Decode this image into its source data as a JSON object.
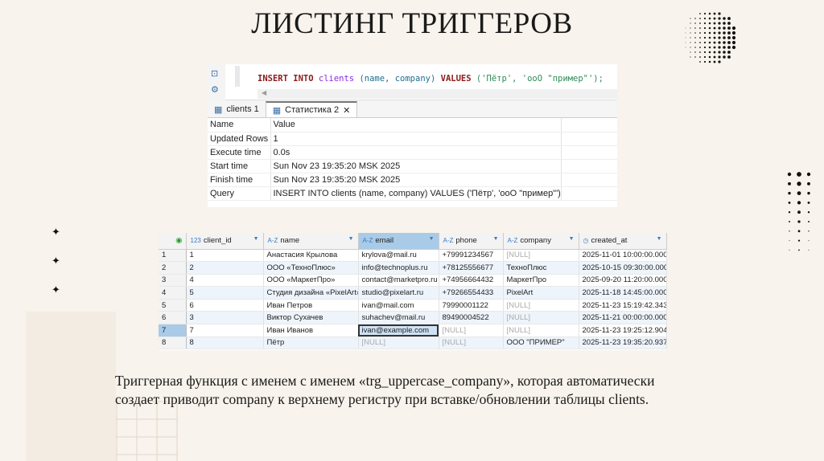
{
  "title": "ЛИСТИНГ ТРИГГЕРОВ",
  "editor": {
    "kw1": "INSERT INTO",
    "table": "clients",
    "cols": "(name, company)",
    "kw2": "VALUES",
    "vals": "('Пётр', 'ооО \"пример\"');",
    "scroll_left": "◀"
  },
  "tabs": [
    {
      "label": "clients 1"
    },
    {
      "label": "Статистика 2",
      "close": "✕"
    }
  ],
  "stats": {
    "header": [
      "Name",
      "Value"
    ],
    "rows": [
      [
        "Updated Rows",
        "1"
      ],
      [
        "Execute time",
        "0.0s"
      ],
      [
        "Start time",
        "Sun Nov 23 19:35:20 MSK 2025"
      ],
      [
        "Finish time",
        "Sun Nov 23 19:35:20 MSK 2025"
      ],
      [
        "Query",
        "INSERT INTO clients (name, company) VALUES ('Пётр', 'ооО \"пример\"')"
      ]
    ]
  },
  "grid": {
    "columns": [
      {
        "type": "123",
        "name": "client_id"
      },
      {
        "type": "A-Z",
        "name": "name"
      },
      {
        "type": "A-Z",
        "name": "email"
      },
      {
        "type": "A-Z",
        "name": "phone"
      },
      {
        "type": "A-Z",
        "name": "company"
      },
      {
        "type": "◷",
        "name": "created_at"
      }
    ],
    "rows": [
      [
        "1",
        "1",
        "Анастасия Крылова",
        "krylova@mail.ru",
        "+79991234567",
        "[NULL]",
        "2025-11-01 10:00:00.000"
      ],
      [
        "2",
        "2",
        "ООО «ТехноПлюс»",
        "info@technoplus.ru",
        "+78125556677",
        "ТехноПлюс",
        "2025-10-15 09:30:00.000"
      ],
      [
        "3",
        "4",
        "ООО «МаркетПро»",
        "contact@marketpro.ru",
        "+74956664432",
        "МаркетПро",
        "2025-09-20 11:20:00.000"
      ],
      [
        "4",
        "5",
        "Студия дизайна «PixelArt»",
        "studio@pixelart.ru",
        "+79266554433",
        "PixelArt",
        "2025-11-18 14:45:00.000"
      ],
      [
        "5",
        "6",
        "Иван Петров",
        "ivan@mail.com",
        "79990001122",
        "[NULL]",
        "2025-11-23 15:19:42.343"
      ],
      [
        "6",
        "3",
        "Виктор Сухачев",
        "suhachev@mail.ru",
        "89490004522",
        "[NULL]",
        "2025-11-21 00:00:00.000"
      ],
      [
        "7",
        "7",
        "Иван Иванов",
        "ivan@example.com",
        "[NULL]",
        "[NULL]",
        "2025-11-23 19:25:12.904"
      ],
      [
        "8",
        "8",
        "Пётр",
        "[NULL]",
        "[NULL]",
        "ООО \"ПРИМЕР\"",
        "2025-11-23 19:35:20.937"
      ]
    ]
  },
  "caption": {
    "line1": "Триггерная функция с именем с именем «trg_uppercase_company», которая автоматически",
    "line2": "создает приводит company к верхнему регистру при вставке/обновлении таблицы clients."
  }
}
